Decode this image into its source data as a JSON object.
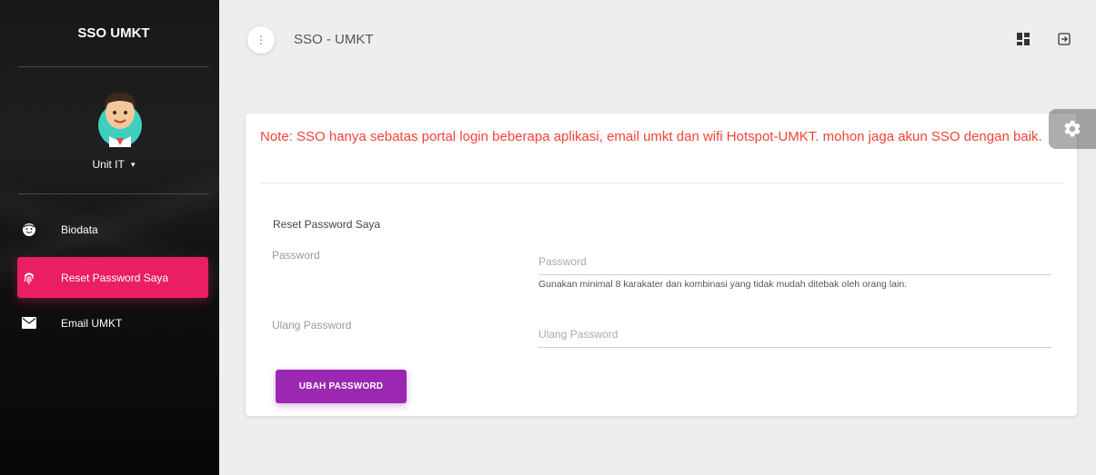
{
  "sidebar": {
    "brand": "SSO UMKT",
    "user": {
      "name": "Unit IT",
      "caret": "▾"
    },
    "items": [
      {
        "label": "Biodata",
        "icon": "face-icon",
        "active": false
      },
      {
        "label": "Reset Password Saya",
        "icon": "fingerprint-icon",
        "active": true
      },
      {
        "label": "Email UMKT",
        "icon": "mail-icon",
        "active": false
      }
    ]
  },
  "topbar": {
    "menu_glyph": "⋮",
    "title": "SSO - UMKT",
    "icons": [
      "dashboard-icon",
      "logout-icon"
    ]
  },
  "card": {
    "note": "Note: SSO hanya sebatas portal login beberapa aplikasi, email umkt dan wifi Hotspot-UMKT. mohon jaga akun SSO dengan baik.",
    "section_title": "Reset Password Saya",
    "password": {
      "label": "Password",
      "placeholder": "Password",
      "value": "",
      "help": "Gunakan minimal 8 karakater dan kombinasi yang tidak mudah ditebak oleh orang lain."
    },
    "repeat_password": {
      "label": "Ulang Password",
      "placeholder": "Ulang Password",
      "value": ""
    },
    "submit_label": "UBAH PASSWORD"
  },
  "fixed_plugin": {
    "icon": "gear-icon"
  },
  "colors": {
    "accent_active": "#e91e63",
    "button": "#9c27b0",
    "note": "#f44336",
    "background": "#eeeeee"
  }
}
